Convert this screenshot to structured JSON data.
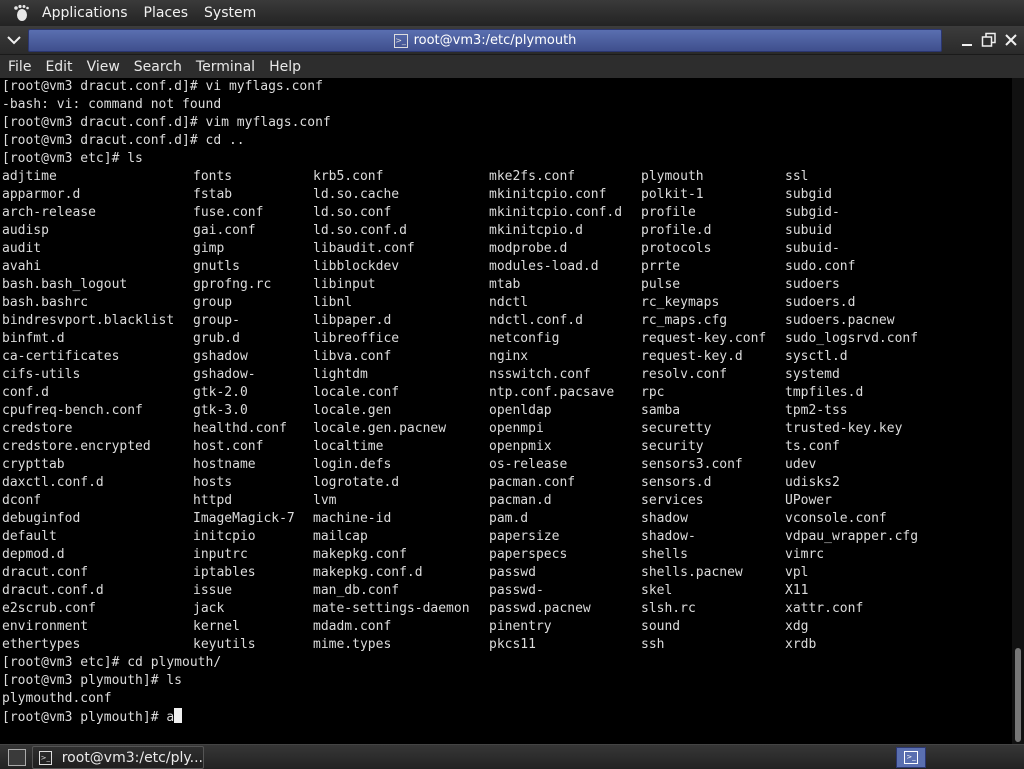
{
  "top_panel": {
    "menus": [
      "Applications",
      "Places",
      "System"
    ]
  },
  "window": {
    "title": "root@vm3:/etc/plymouth"
  },
  "menubar": {
    "items": [
      "File",
      "Edit",
      "View",
      "Search",
      "Terminal",
      "Help"
    ]
  },
  "terminal": {
    "lines_before": [
      "[root@vm3 dracut.conf.d]# vi myflags.conf",
      "-bash: vi: command not found",
      "[root@vm3 dracut.conf.d]# vim myflags.conf",
      "[root@vm3 dracut.conf.d]# cd ..",
      "[root@vm3 etc]# ls"
    ],
    "ls_rows": [
      [
        "adjtime",
        "fonts",
        "krb5.conf",
        "mke2fs.conf",
        "plymouth",
        "ssl"
      ],
      [
        "apparmor.d",
        "fstab",
        "ld.so.cache",
        "mkinitcpio.conf",
        "polkit-1",
        "subgid"
      ],
      [
        "arch-release",
        "fuse.conf",
        "ld.so.conf",
        "mkinitcpio.conf.d",
        "profile",
        "subgid-"
      ],
      [
        "audisp",
        "gai.conf",
        "ld.so.conf.d",
        "mkinitcpio.d",
        "profile.d",
        "subuid"
      ],
      [
        "audit",
        "gimp",
        "libaudit.conf",
        "modprobe.d",
        "protocols",
        "subuid-"
      ],
      [
        "avahi",
        "gnutls",
        "libblockdev",
        "modules-load.d",
        "prrte",
        "sudo.conf"
      ],
      [
        "bash.bash_logout",
        "gprofng.rc",
        "libinput",
        "mtab",
        "pulse",
        "sudoers"
      ],
      [
        "bash.bashrc",
        "group",
        "libnl",
        "ndctl",
        "rc_keymaps",
        "sudoers.d"
      ],
      [
        "bindresvport.blacklist",
        "group-",
        "libpaper.d",
        "ndctl.conf.d",
        "rc_maps.cfg",
        "sudoers.pacnew"
      ],
      [
        "binfmt.d",
        "grub.d",
        "libreoffice",
        "netconfig",
        "request-key.conf",
        "sudo_logsrvd.conf"
      ],
      [
        "ca-certificates",
        "gshadow",
        "libva.conf",
        "nginx",
        "request-key.d",
        "sysctl.d"
      ],
      [
        "cifs-utils",
        "gshadow-",
        "lightdm",
        "nsswitch.conf",
        "resolv.conf",
        "systemd"
      ],
      [
        "conf.d",
        "gtk-2.0",
        "locale.conf",
        "ntp.conf.pacsave",
        "rpc",
        "tmpfiles.d"
      ],
      [
        "cpufreq-bench.conf",
        "gtk-3.0",
        "locale.gen",
        "openldap",
        "samba",
        "tpm2-tss"
      ],
      [
        "credstore",
        "healthd.conf",
        "locale.gen.pacnew",
        "openmpi",
        "securetty",
        "trusted-key.key"
      ],
      [
        "credstore.encrypted",
        "host.conf",
        "localtime",
        "openpmix",
        "security",
        "ts.conf"
      ],
      [
        "crypttab",
        "hostname",
        "login.defs",
        "os-release",
        "sensors3.conf",
        "udev"
      ],
      [
        "daxctl.conf.d",
        "hosts",
        "logrotate.d",
        "pacman.conf",
        "sensors.d",
        "udisks2"
      ],
      [
        "dconf",
        "httpd",
        "lvm",
        "pacman.d",
        "services",
        "UPower"
      ],
      [
        "debuginfod",
        "ImageMagick-7",
        "machine-id",
        "pam.d",
        "shadow",
        "vconsole.conf"
      ],
      [
        "default",
        "initcpio",
        "mailcap",
        "papersize",
        "shadow-",
        "vdpau_wrapper.cfg"
      ],
      [
        "depmod.d",
        "inputrc",
        "makepkg.conf",
        "paperspecs",
        "shells",
        "vimrc"
      ],
      [
        "dracut.conf",
        "iptables",
        "makepkg.conf.d",
        "passwd",
        "shells.pacnew",
        "vpl"
      ],
      [
        "dracut.conf.d",
        "issue",
        "man_db.conf",
        "passwd-",
        "skel",
        "X11"
      ],
      [
        "e2scrub.conf",
        "jack",
        "mate-settings-daemon",
        "passwd.pacnew",
        "slsh.rc",
        "xattr.conf"
      ],
      [
        "environment",
        "kernel",
        "mdadm.conf",
        "pinentry",
        "sound",
        "xdg"
      ],
      [
        "ethertypes",
        "keyutils",
        "mime.types",
        "pkcs11",
        "ssh",
        "xrdb"
      ]
    ],
    "lines_after": [
      "[root@vm3 etc]# cd plymouth/",
      "[root@vm3 plymouth]# ls",
      "plymouthd.conf"
    ],
    "prompt": "[root@vm3 plymouth]# ",
    "current_input": "a"
  },
  "taskbar": {
    "task_label": "root@vm3:/etc/ply..."
  }
}
